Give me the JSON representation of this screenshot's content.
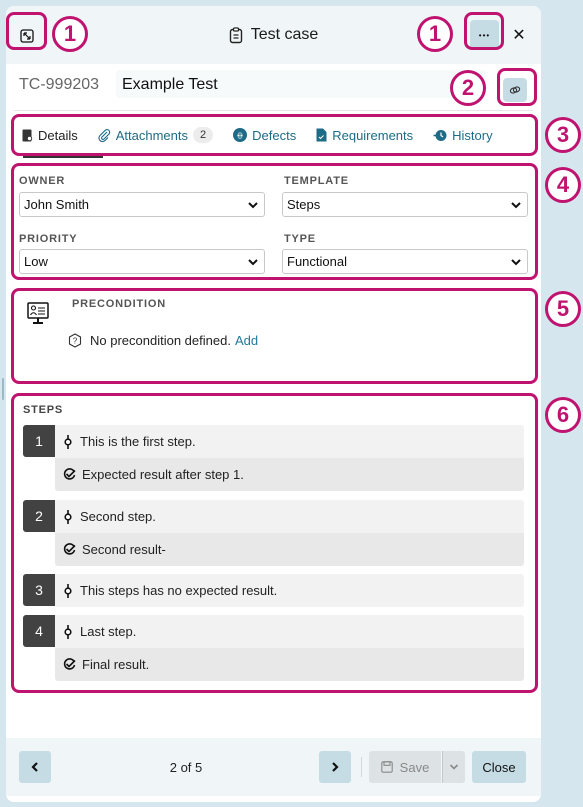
{
  "header": {
    "title": "Test case",
    "icons": {
      "expand": "expand-arrows-icon",
      "title": "clipboard-icon",
      "more": "ellipsis-icon",
      "close": "close-icon"
    },
    "more_label": "•••",
    "close_label": "✕"
  },
  "test_case": {
    "id": "TC-999203",
    "name": "Example Test",
    "link_icon": "link-icon"
  },
  "tabs": [
    {
      "label": "Details",
      "icon": "details-icon",
      "active": true
    },
    {
      "label": "Attachments",
      "icon": "paperclip-icon",
      "badge": "2"
    },
    {
      "label": "Defects",
      "icon": "bug-icon"
    },
    {
      "label": "Requirements",
      "icon": "document-icon"
    },
    {
      "label": "History",
      "icon": "history-icon"
    }
  ],
  "fields": {
    "owner": {
      "label": "OWNER",
      "value": "John Smith"
    },
    "template": {
      "label": "TEMPLATE",
      "value": "Steps"
    },
    "priority": {
      "label": "PRIORITY",
      "value": "Low"
    },
    "type": {
      "label": "TYPE",
      "value": "Functional"
    }
  },
  "precondition": {
    "label": "PRECONDITION",
    "message": "No precondition defined.",
    "add_link": "Add"
  },
  "steps": {
    "label": "STEPS",
    "items": [
      {
        "number": "1",
        "action": "This is the first step.",
        "expected": "Expected result after step 1."
      },
      {
        "number": "2",
        "action": "Second step.",
        "expected": "Second result-"
      },
      {
        "number": "3",
        "action": "This steps has no expected result.",
        "expected": null
      },
      {
        "number": "4",
        "action": "Last step.",
        "expected": "Final result."
      }
    ]
  },
  "footer": {
    "prev_label": "‹",
    "next_label": "›",
    "pager": "2 of 5",
    "save_label": "Save",
    "close_label": "Close"
  },
  "callouts": [
    "1",
    "1",
    "2",
    "3",
    "4",
    "5",
    "6"
  ],
  "colors": {
    "highlight": "#c0136f",
    "accent": "#1d6b87",
    "button_bg": "#c6dce5"
  }
}
